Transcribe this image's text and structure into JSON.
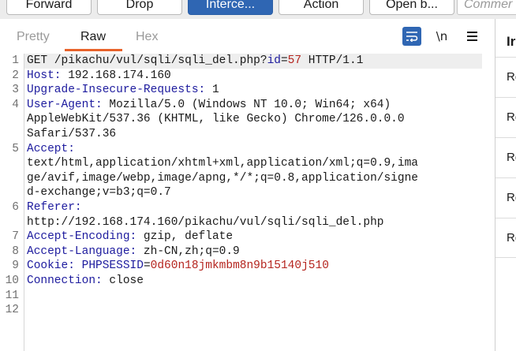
{
  "toolbar": {
    "forward": "Forward",
    "drop": "Drop",
    "intercept": "Interce...",
    "action": "Action",
    "open_browser": "Open b...",
    "comment_placeholder": "Commer"
  },
  "editor": {
    "tabs": [
      "Pretty",
      "Raw",
      "Hex"
    ],
    "active_tab": "Raw",
    "icons": {
      "wrap": "wrap-lines-icon",
      "newline_label": "\\n",
      "menu": "hamburger-menu-icon"
    },
    "line_numbers": [
      "1",
      "2",
      "3",
      "4",
      "5",
      "6",
      "7",
      "8",
      "9",
      "10",
      "11",
      "12"
    ],
    "lines": {
      "l1": {
        "method": "GET /pikachu/vul/sqli/sqli_del.php?",
        "pname": "id",
        "eq": "=",
        "pval": "57",
        "tail": " HTTP/1.1"
      },
      "l2": {
        "key": "Host:",
        "val": " 192.168.174.160"
      },
      "l3": {
        "key": "Upgrade-Insecure-Requests:",
        "val": " 1"
      },
      "l4": {
        "key": "User-Agent:",
        "val": " Mozilla/5.0 (Windows NT 10.0; Win64; x64)"
      },
      "l4b": "AppleWebKit/537.36 (KHTML, like Gecko) Chrome/126.0.0.0",
      "l4c": "Safari/537.36",
      "l5": {
        "key": "Accept:"
      },
      "l5b": "text/html,application/xhtml+xml,application/xml;q=0.9,ima",
      "l5c": "ge/avif,image/webp,image/apng,*/*;q=0.8,application/signe",
      "l5d": "d-exchange;v=b3;q=0.7",
      "l6": {
        "key": "Referer:"
      },
      "l6b": "http://192.168.174.160/pikachu/vul/sqli/sqli_del.php",
      "l7": {
        "key": "Accept-Encoding:",
        "val": " gzip, deflate"
      },
      "l8": {
        "key": "Accept-Language:",
        "val": " zh-CN,zh;q=0.9"
      },
      "l9": {
        "key": "Cookie:",
        "sp": " ",
        "cname": "PHPSESSID",
        "eq": "=",
        "cval": "0d60n18jmkmbm8n9b15140j510"
      },
      "l10": {
        "key": "Connection:",
        "val": " close"
      }
    }
  },
  "side_panel": {
    "title": "Ir",
    "rows": [
      "Re",
      "Re",
      "Re",
      "Re",
      "Re"
    ]
  },
  "colors": {
    "accent": "#2f66b3",
    "tab_underline": "#e8632b",
    "header_key": "#1d1b9e",
    "param_value": "#b5251f"
  }
}
